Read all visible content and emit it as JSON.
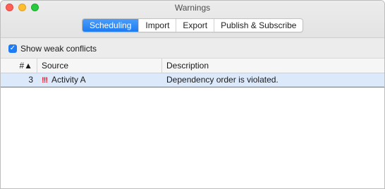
{
  "window": {
    "title": "Warnings"
  },
  "tabs": [
    {
      "label": "Scheduling",
      "active": true
    },
    {
      "label": "Import",
      "active": false
    },
    {
      "label": "Export",
      "active": false
    },
    {
      "label": "Publish & Subscribe",
      "active": false
    }
  ],
  "options": {
    "show_weak_conflicts_label": "Show weak conflicts",
    "show_weak_conflicts_checked": true
  },
  "table": {
    "columns": {
      "number": "#▲",
      "source": "Source",
      "description": "Description"
    },
    "rows": [
      {
        "number": "3",
        "warning_icon": "!!!",
        "source": "Activity A",
        "description": "Dependency order is violated."
      }
    ]
  },
  "colors": {
    "accent": "#1d7cf2",
    "selected_row": "#dce9fb",
    "warning": "#e0202d"
  },
  "icons": [
    "close-icon",
    "minimize-icon",
    "maximize-icon",
    "checkmark-icon",
    "sort-ascending-icon",
    "warning-icon"
  ]
}
